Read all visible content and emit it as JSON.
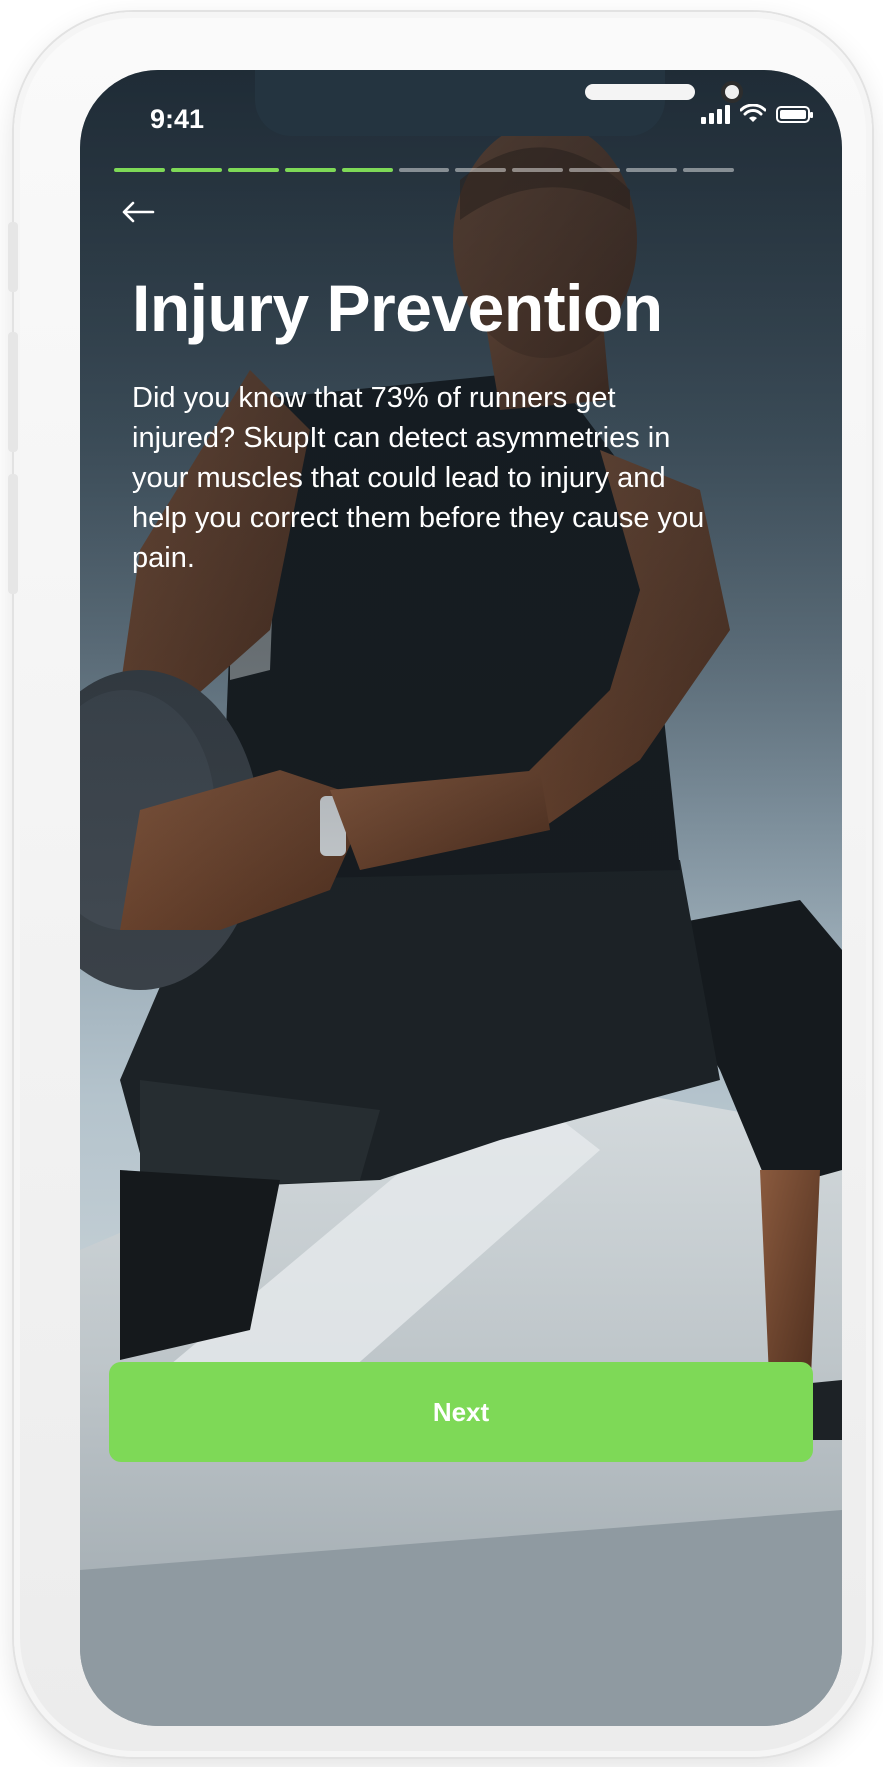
{
  "status_bar": {
    "time": "9:41",
    "icons": [
      "cellular-signal-icon",
      "wifi-icon",
      "battery-icon"
    ]
  },
  "onboarding": {
    "total_steps": 11,
    "completed_steps": 5,
    "title": "Injury Prevention",
    "description": "Did you know that 73% of runners get injured? SkupIt can detect asymmetries in your muscles that could lead to injury and help you correct them before they cause you pain.",
    "next_label": "Next",
    "back_icon": "arrow-left-icon"
  },
  "colors": {
    "accent": "#7ed957",
    "text": "#ffffff"
  }
}
